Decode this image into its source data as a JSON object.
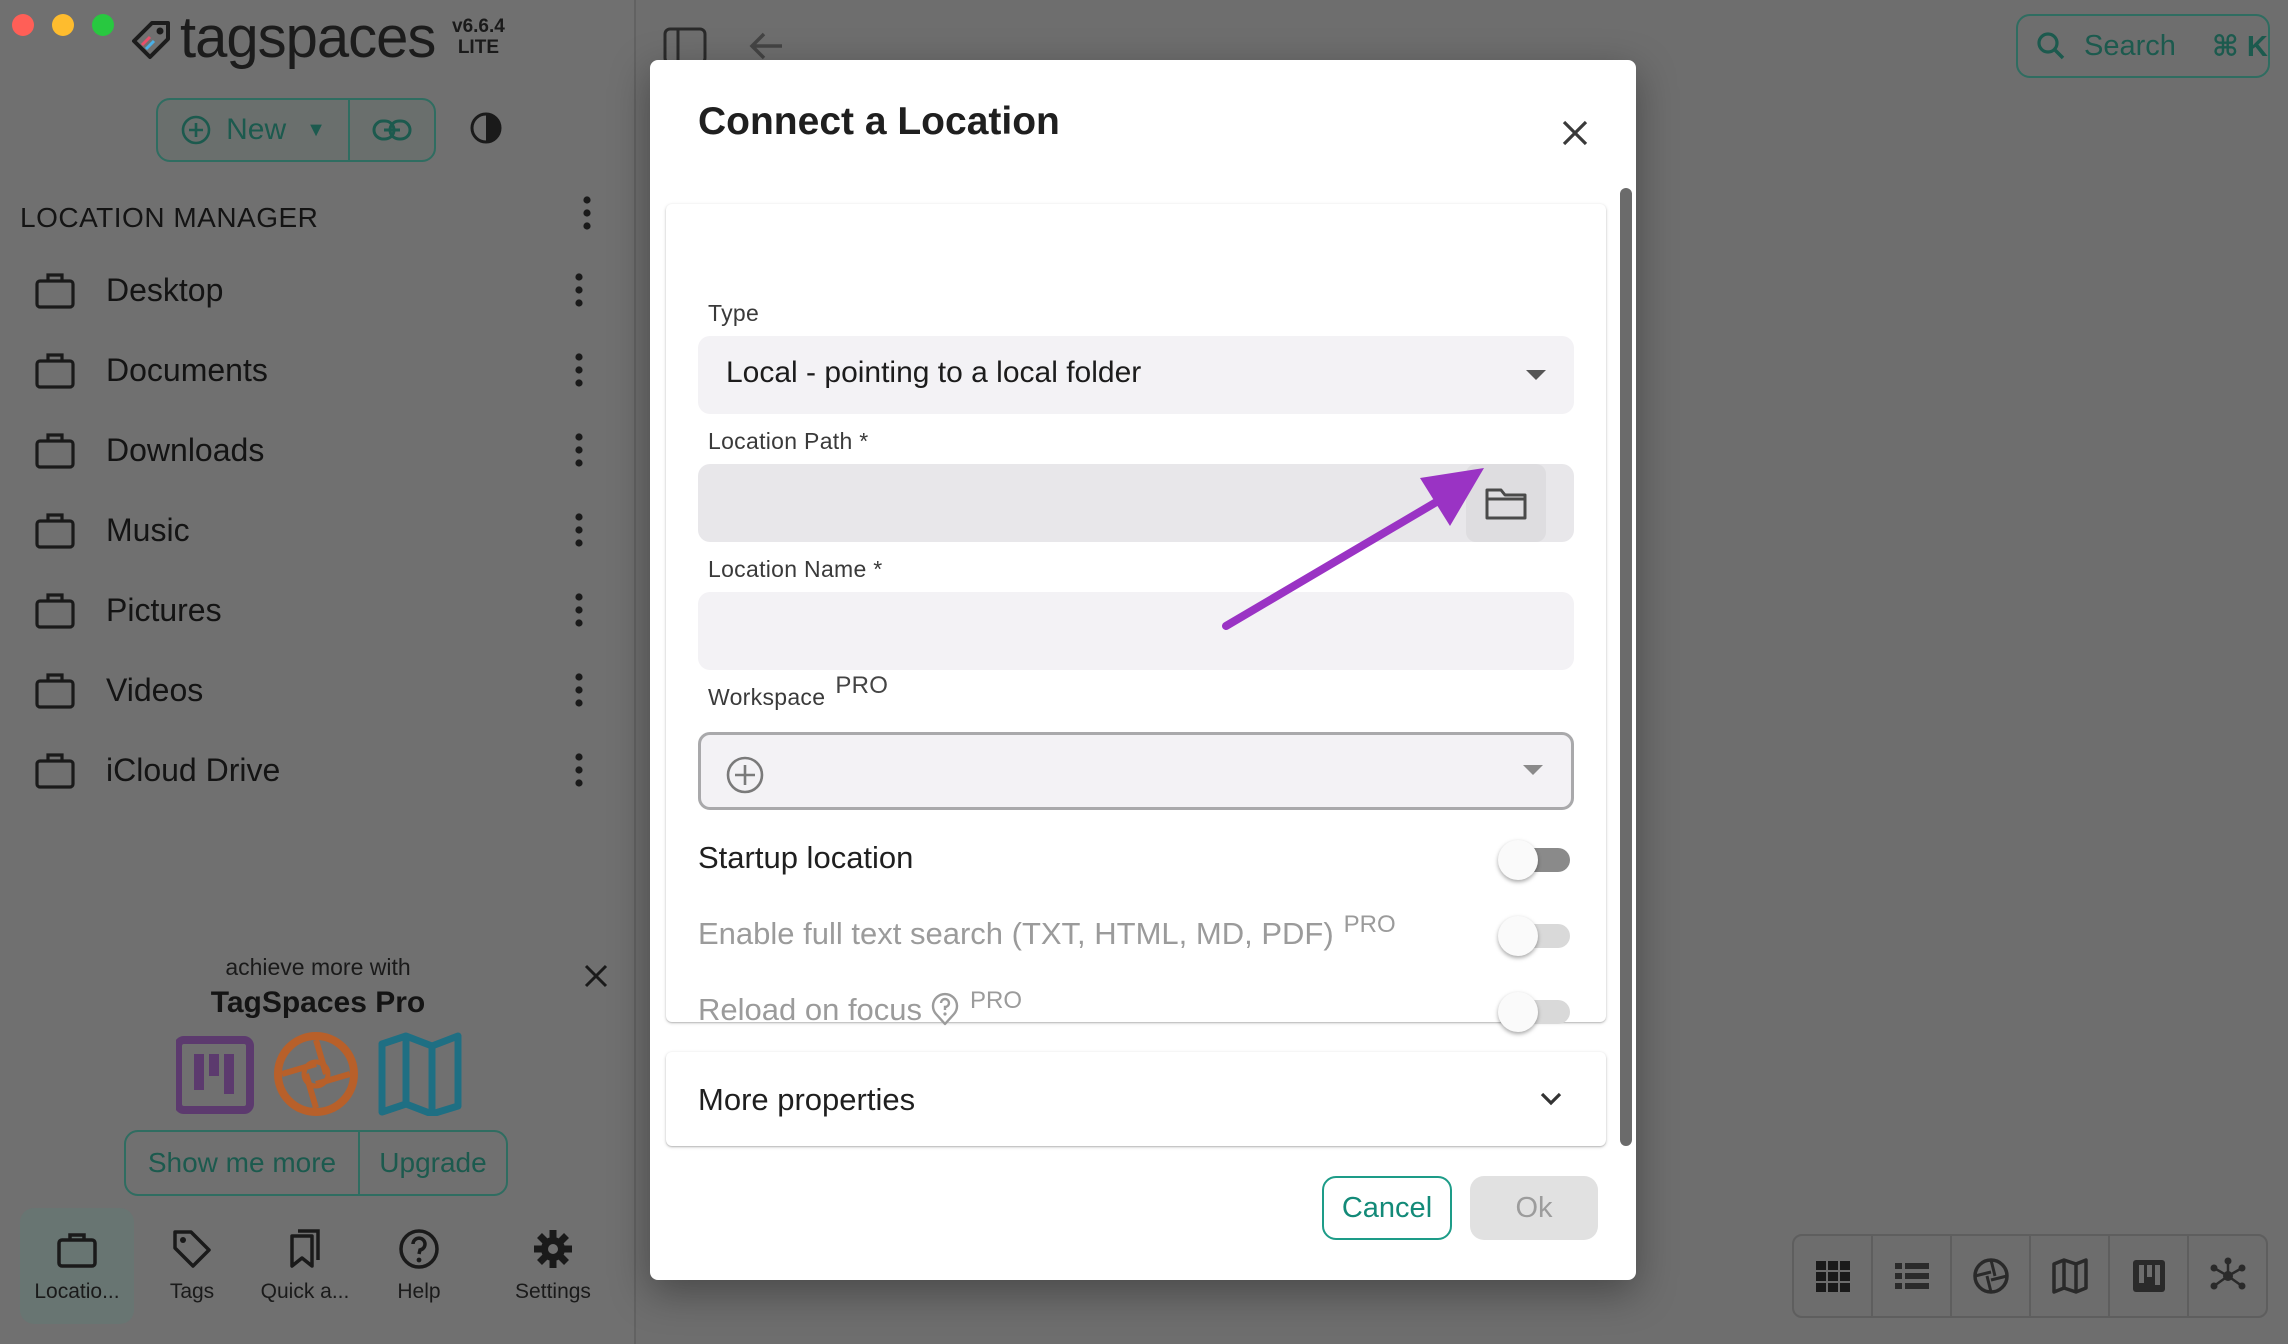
{
  "app": {
    "name": "tagspaces",
    "version": "v6.6.4",
    "edition": "LITE"
  },
  "toolbar": {
    "new_label": "New"
  },
  "location_manager": {
    "title": "LOCATION MANAGER",
    "items": [
      {
        "label": "Desktop"
      },
      {
        "label": "Documents"
      },
      {
        "label": "Downloads"
      },
      {
        "label": "Music"
      },
      {
        "label": "Pictures"
      },
      {
        "label": "Videos"
      },
      {
        "label": "iCloud Drive"
      }
    ]
  },
  "promo": {
    "subtitle": "achieve more with",
    "title": "TagSpaces Pro",
    "show_more": "Show me more",
    "upgrade": "Upgrade"
  },
  "bottom_nav": [
    {
      "label": "Locatio..."
    },
    {
      "label": "Tags"
    },
    {
      "label": "Quick a..."
    },
    {
      "label": "Help"
    },
    {
      "label": "Settings"
    }
  ],
  "search": {
    "label": "Search",
    "shortcut": "⌘ K"
  },
  "dialog": {
    "title": "Connect a Location",
    "type_label": "Type",
    "type_value": "Local - pointing to a local folder",
    "path_label": "Location Path *",
    "path_value": "",
    "name_label": "Location Name *",
    "name_value": "",
    "workspace_label": "Workspace",
    "workspace_badge": "PRO",
    "startup_label": "Startup location",
    "fulltext_label": "Enable full text search (TXT, HTML, MD, PDF)",
    "fulltext_badge": "PRO",
    "reload_label": "Reload on focus",
    "reload_badge": "PRO",
    "more_properties": "More properties",
    "cancel": "Cancel",
    "ok": "Ok"
  },
  "colors": {
    "accent": "#1d9c88",
    "annotation_arrow": "#9a33c4"
  }
}
